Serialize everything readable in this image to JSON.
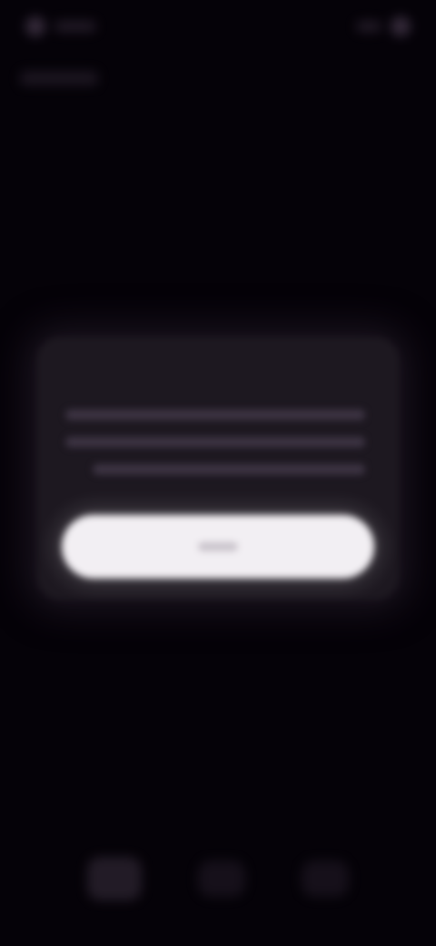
{
  "screen": {
    "background_color": "#050208",
    "state": "blurred"
  },
  "status_bar": {
    "icons": [
      "status-dot",
      "status-pill"
    ],
    "right_icons": [
      "status-pill",
      "status-dot"
    ]
  },
  "dialog": {
    "title": "",
    "body_lines": 3,
    "primary_button_label": "",
    "card_color": "#1d1820",
    "button_color": "#f2eff3"
  },
  "bottom_nav": {
    "items": 3
  }
}
